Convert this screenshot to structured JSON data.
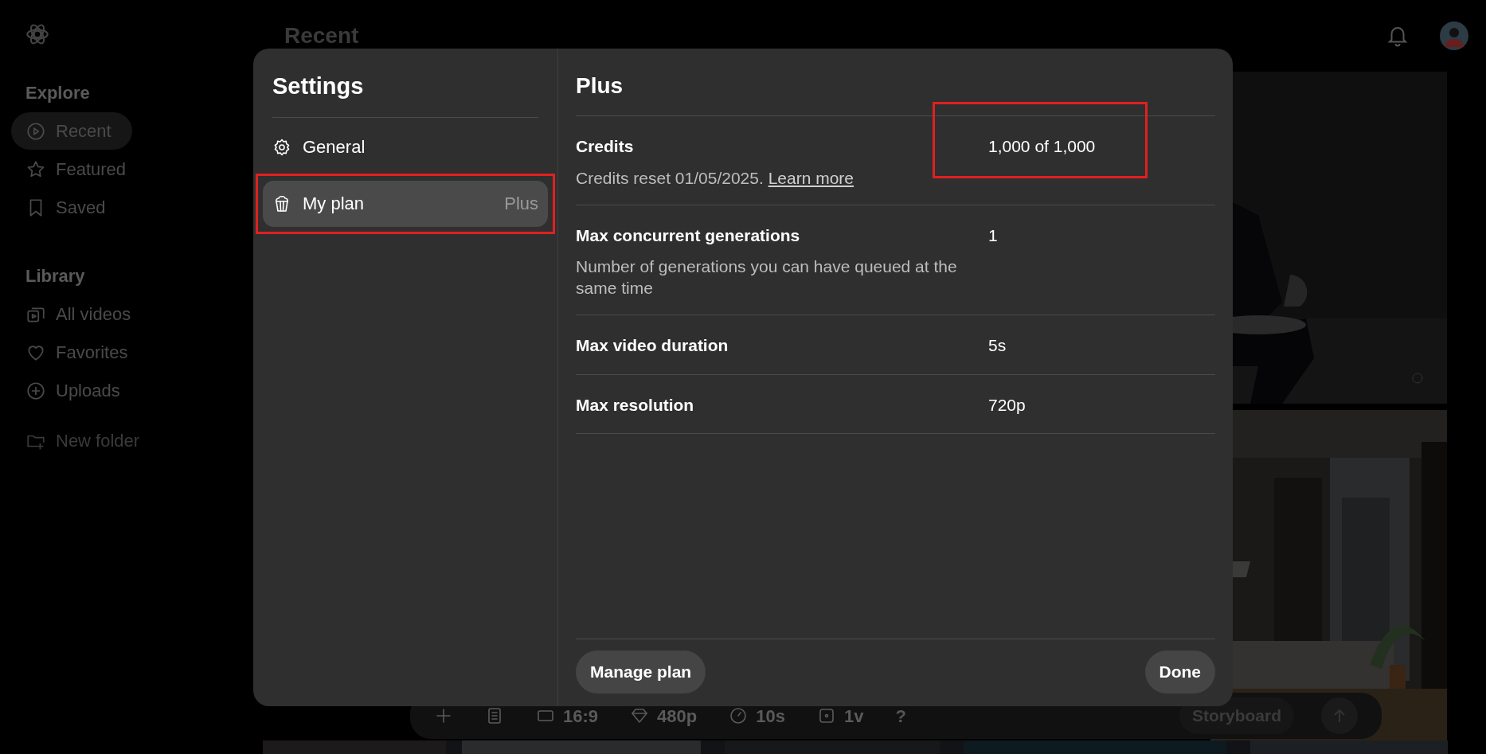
{
  "app_sidebar": {
    "sections": [
      {
        "heading": "Explore",
        "items": [
          {
            "label": "Recent",
            "selected": true
          },
          {
            "label": "Featured",
            "selected": false
          },
          {
            "label": "Saved",
            "selected": false
          }
        ]
      },
      {
        "heading": "Library",
        "items": [
          {
            "label": "All videos",
            "selected": false
          },
          {
            "label": "Favorites",
            "selected": false
          },
          {
            "label": "Uploads",
            "selected": false
          }
        ]
      }
    ],
    "new_folder": "New folder"
  },
  "page_title": "Recent",
  "composer_toolbar": {
    "items": [
      {
        "kind": "plus"
      },
      {
        "kind": "document"
      },
      {
        "kind": "aspect",
        "label": "16:9"
      },
      {
        "kind": "diamond",
        "label": "480p"
      },
      {
        "kind": "clock",
        "label": "10s"
      },
      {
        "kind": "square",
        "label": "1v"
      },
      {
        "kind": "text",
        "label": "?"
      }
    ],
    "storyboard": "Storyboard"
  },
  "settings": {
    "title": "Settings",
    "nav": [
      {
        "label": "General",
        "selected": false,
        "highlighted": false
      },
      {
        "label": "My plan",
        "badge": "Plus",
        "selected": true,
        "highlighted": true
      }
    ],
    "panel_title": "Plus",
    "rows": [
      {
        "label": "Credits",
        "description": "Credits reset 01/05/2025. ",
        "link": "Learn more",
        "value": "1,000 of 1,000",
        "highlighted": true
      },
      {
        "label": "Max concurrent generations",
        "description": "Number of generations you can have queued at the same time",
        "value": "1",
        "highlighted": false
      },
      {
        "label": "Max video duration",
        "value": "5s",
        "highlighted": false
      },
      {
        "label": "Max resolution",
        "value": "720p",
        "highlighted": false
      }
    ],
    "manage_button": "Manage plan",
    "done_button": "Done"
  }
}
